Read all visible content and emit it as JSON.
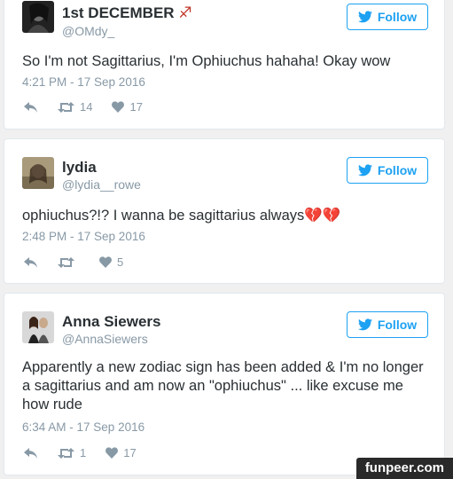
{
  "tweets": [
    {
      "name": "1st DECEMBER",
      "name_emoji": "♐",
      "handle": "@OMdy_",
      "follow_label": "Follow",
      "text": "So I'm not Sagittarius, I'm Ophiuchus hahaha! Okay wow",
      "timestamp": "4:21 PM - 17 Sep 2016",
      "retweets": "14",
      "likes": "17"
    },
    {
      "name": "lydia",
      "handle": "@lydia__rowe",
      "follow_label": "Follow",
      "text": "ophiuchus?!? I wanna be sagittarius always",
      "text_emoji": "💔💔",
      "timestamp": "2:48 PM - 17 Sep 2016",
      "retweets": "",
      "likes": "5"
    },
    {
      "name": "Anna Siewers",
      "handle": "@AnnaSiewers",
      "follow_label": "Follow",
      "text": "Apparently a new zodiac sign has been added & I'm no longer a sagittarius and am now an \"ophiuchus\" ... like excuse me how rude",
      "timestamp": "6:34 AM - 17 Sep 2016",
      "retweets": "1",
      "likes": "17"
    }
  ],
  "watermark": "funpeer.com",
  "colors": {
    "accent": "#1da1f2",
    "muted": "#8899a6",
    "broken_heart": "#dd2e44"
  },
  "icons": [
    "twitter-bird-icon",
    "reply-icon",
    "retweet-icon",
    "heart-icon",
    "sagittarius-icon",
    "broken-heart-icon"
  ]
}
